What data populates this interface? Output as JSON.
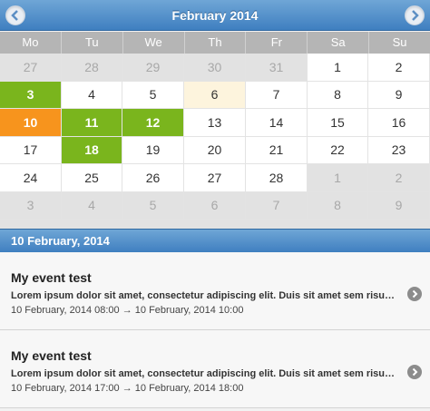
{
  "header": {
    "title": "February 2014",
    "prev_icon": "chevron-left-icon",
    "next_icon": "chevron-right-icon"
  },
  "weekdays": [
    "Mo",
    "Tu",
    "We",
    "Th",
    "Fr",
    "Sa",
    "Su"
  ],
  "days": [
    {
      "label": "27",
      "state": "other"
    },
    {
      "label": "28",
      "state": "other"
    },
    {
      "label": "29",
      "state": "other"
    },
    {
      "label": "30",
      "state": "other"
    },
    {
      "label": "31",
      "state": "other"
    },
    {
      "label": "1",
      "state": "normal"
    },
    {
      "label": "2",
      "state": "normal"
    },
    {
      "label": "3",
      "state": "event"
    },
    {
      "label": "4",
      "state": "normal"
    },
    {
      "label": "5",
      "state": "normal"
    },
    {
      "label": "6",
      "state": "today"
    },
    {
      "label": "7",
      "state": "normal"
    },
    {
      "label": "8",
      "state": "normal"
    },
    {
      "label": "9",
      "state": "normal"
    },
    {
      "label": "10",
      "state": "selected"
    },
    {
      "label": "11",
      "state": "event"
    },
    {
      "label": "12",
      "state": "event"
    },
    {
      "label": "13",
      "state": "normal"
    },
    {
      "label": "14",
      "state": "normal"
    },
    {
      "label": "15",
      "state": "normal"
    },
    {
      "label": "16",
      "state": "normal"
    },
    {
      "label": "17",
      "state": "normal"
    },
    {
      "label": "18",
      "state": "event"
    },
    {
      "label": "19",
      "state": "normal"
    },
    {
      "label": "20",
      "state": "normal"
    },
    {
      "label": "21",
      "state": "normal"
    },
    {
      "label": "22",
      "state": "normal"
    },
    {
      "label": "23",
      "state": "normal"
    },
    {
      "label": "24",
      "state": "normal"
    },
    {
      "label": "25",
      "state": "normal"
    },
    {
      "label": "26",
      "state": "normal"
    },
    {
      "label": "27",
      "state": "normal"
    },
    {
      "label": "28",
      "state": "normal"
    },
    {
      "label": "1",
      "state": "other"
    },
    {
      "label": "2",
      "state": "other"
    },
    {
      "label": "3",
      "state": "other"
    },
    {
      "label": "4",
      "state": "other"
    },
    {
      "label": "5",
      "state": "other"
    },
    {
      "label": "6",
      "state": "other"
    },
    {
      "label": "7",
      "state": "other"
    },
    {
      "label": "8",
      "state": "other"
    },
    {
      "label": "9",
      "state": "other"
    }
  ],
  "colors": {
    "accent": "#3f7fc0",
    "event": "#7ab51d",
    "selected": "#f7941d",
    "today": "#fdf4dd"
  },
  "selected_date": "10 February, 2014",
  "events": [
    {
      "title": "My event test",
      "description": "Lorem ipsum dolor sit amet, consectetur adipiscing elit. Duis sit amet sem risus. Curabitur",
      "start": "10 February, 2014 08:00",
      "arrow": "→",
      "end": "10 February, 2014 10:00",
      "icon": "chevron-right-icon"
    },
    {
      "title": "My event test",
      "description": "Lorem ipsum dolor sit amet, consectetur adipiscing elit. Duis sit amet sem risus. Curabitur",
      "start": "10 February, 2014 17:00",
      "arrow": "→",
      "end": "10 February, 2014 18:00",
      "icon": "chevron-right-icon"
    }
  ]
}
